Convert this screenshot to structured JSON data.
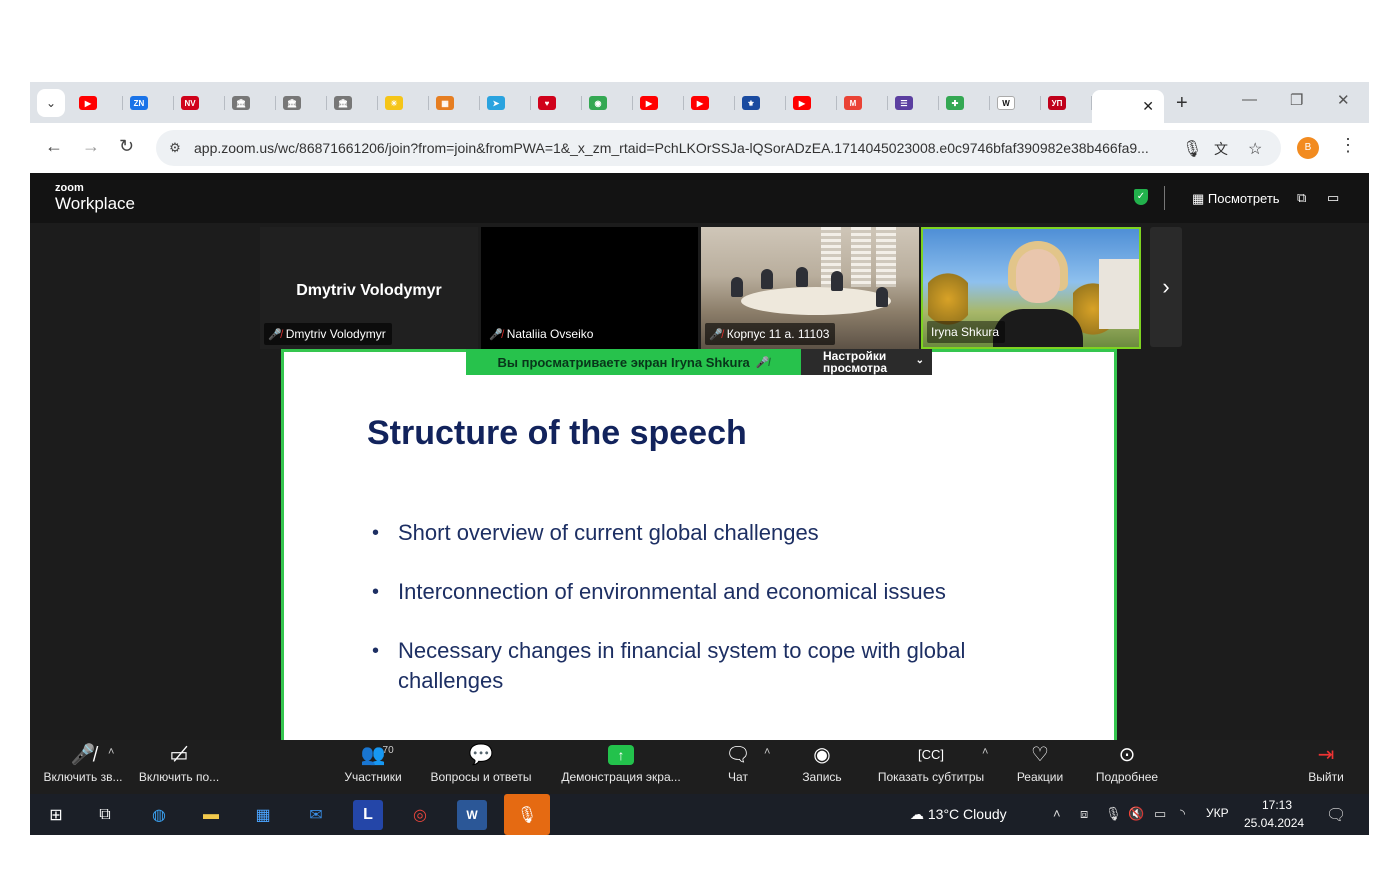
{
  "browser": {
    "tabs": [
      {
        "icon": "youtube-icon",
        "color": "#ff0000",
        "glyph": "▶"
      },
      {
        "icon": "zn-icon",
        "color": "#1a73e8",
        "glyph": "ZN"
      },
      {
        "icon": "nv-icon",
        "color": "#d0021b",
        "glyph": "NV"
      },
      {
        "icon": "gov-building-icon",
        "color": "#777777",
        "glyph": "🏛"
      },
      {
        "icon": "gov-building-icon",
        "color": "#777777",
        "glyph": "🏛"
      },
      {
        "icon": "gov-building-icon",
        "color": "#777777",
        "glyph": "🏛"
      },
      {
        "icon": "sun-icon",
        "color": "#f5c518",
        "glyph": "☀"
      },
      {
        "icon": "news-icon",
        "color": "#e67e22",
        "glyph": "▦"
      },
      {
        "icon": "telegram-icon",
        "color": "#2aa3df",
        "glyph": "➤"
      },
      {
        "icon": "heart-icon",
        "color": "#d0021b",
        "glyph": "♥"
      },
      {
        "icon": "maps-icon",
        "color": "#34a853",
        "glyph": "◉"
      },
      {
        "icon": "youtube-icon",
        "color": "#ff0000",
        "glyph": "▶"
      },
      {
        "icon": "youtube-icon",
        "color": "#ff0000",
        "glyph": "▶"
      },
      {
        "icon": "ukraine-emblem-icon",
        "color": "#1a4ba0",
        "glyph": "⚜"
      },
      {
        "icon": "youtube-icon",
        "color": "#ff0000",
        "glyph": "▶"
      },
      {
        "icon": "gmail-icon",
        "color": "#ea4335",
        "glyph": "M"
      },
      {
        "icon": "list-icon",
        "color": "#5b3fa0",
        "glyph": "☰"
      },
      {
        "icon": "plus-green-icon",
        "color": "#34a853",
        "glyph": "✚"
      },
      {
        "icon": "wikipedia-icon",
        "color": "#ffffff",
        "glyph": "W"
      },
      {
        "icon": "up-icon",
        "color": "#c0001a",
        "glyph": "УП"
      }
    ],
    "active_tab_close": "✕",
    "new_tab": "+",
    "url": "app.zoom.us/wc/86871661206/join?from=join&fromPWA=1&_x_zm_rtaid=PchLKOrSSJa-lQSorADzEA.1714045023008.e0c9746bfaf390982e38b466fa9...",
    "profile_initial": "B"
  },
  "zoom": {
    "logo_small": "zoom",
    "logo": "Workplace",
    "view_label": "Посмотреть",
    "participants": [
      {
        "name": "Dmytriv Volodymyr",
        "label": "Dmytriv Volodymyr",
        "type": "name"
      },
      {
        "name": "",
        "label": "Nataliia Ovseiko",
        "type": "blank"
      },
      {
        "name": "",
        "label": "Корпус 11 а. 11103",
        "type": "room"
      },
      {
        "name": "",
        "label": "Iryna Shkura",
        "type": "video"
      }
    ],
    "share_banner": "Вы просматриваете экран  Iryna Shkura",
    "view_settings": "Настройки просмотра",
    "slide": {
      "title": "Structure of the speech",
      "bullets": [
        "Short overview of current global challenges",
        " Interconnection of environmental and economical issues",
        "Necessary changes in financial system to cope with global challenges"
      ]
    },
    "toolbar": {
      "mic": "Включить зв...",
      "video": "Включить по...",
      "participants": "Участники",
      "participants_count": "70",
      "qa": "Вопросы и ответы",
      "share": "Демонстрация экра...",
      "chat": "Чат",
      "record": "Запись",
      "captions": "Показать субтитры",
      "reactions": "Реакции",
      "more": "Подробнее",
      "leave": "Выйти"
    }
  },
  "taskbar": {
    "weather": "13°C  Cloudy",
    "language": "УКР",
    "time": "17:13",
    "date": "25.04.2024"
  }
}
